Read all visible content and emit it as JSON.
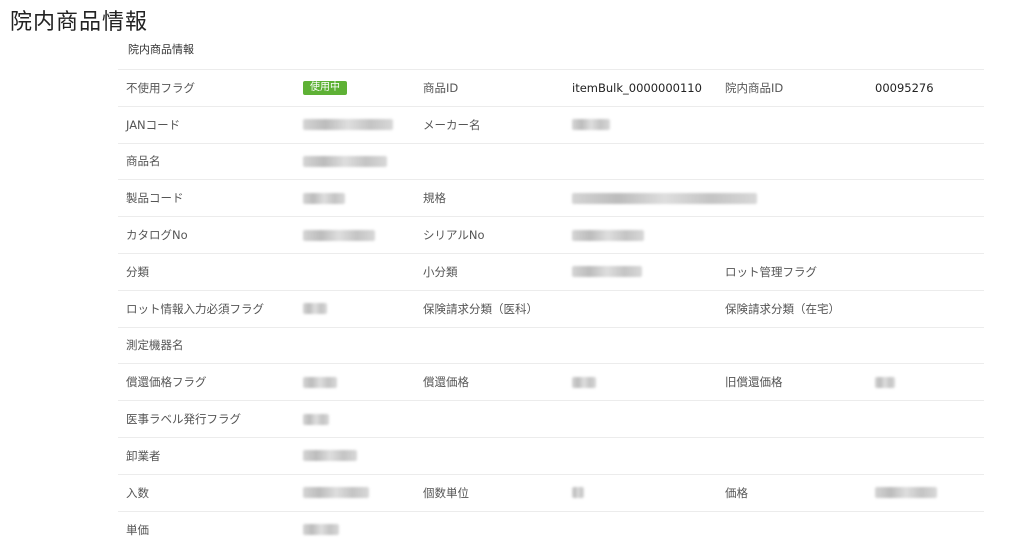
{
  "page": {
    "title": "院内商品情報"
  },
  "section": {
    "title": "院内商品情報"
  },
  "colors": {
    "badge": "#5eb135",
    "border": "#ececec"
  },
  "status_badge": "使用中",
  "labels": {
    "unused_flag": "不使用フラグ",
    "product_id": "商品ID",
    "inhouse_product_id": "院内商品ID",
    "jan_code": "JANコード",
    "maker_name": "メーカー名",
    "product_name": "商品名",
    "product_code": "製品コード",
    "spec": "規格",
    "catalog_no": "カタログNo",
    "serial_no": "シリアルNo",
    "category": "分類",
    "sub_category": "小分類",
    "lot_flag": "ロット管理フラグ",
    "lot_input_flag": "ロット情報入力必須フラグ",
    "insurance_medical": "保険請求分類（医科）",
    "insurance_home": "保険請求分類（在宅）",
    "device_name": "測定機器名",
    "reimb_flag": "償還価格フラグ",
    "reimb_price": "償還価格",
    "old_reimb_price": "旧償還価格",
    "med_label_flag": "医事ラベル発行フラグ",
    "wholesaler": "卸業者",
    "quantity": "入数",
    "unit": "個数単位",
    "price": "価格",
    "unit_price": "単価"
  },
  "values": {
    "product_id": "itemBulk_0000000110",
    "inhouse_product_id": "00095276"
  }
}
